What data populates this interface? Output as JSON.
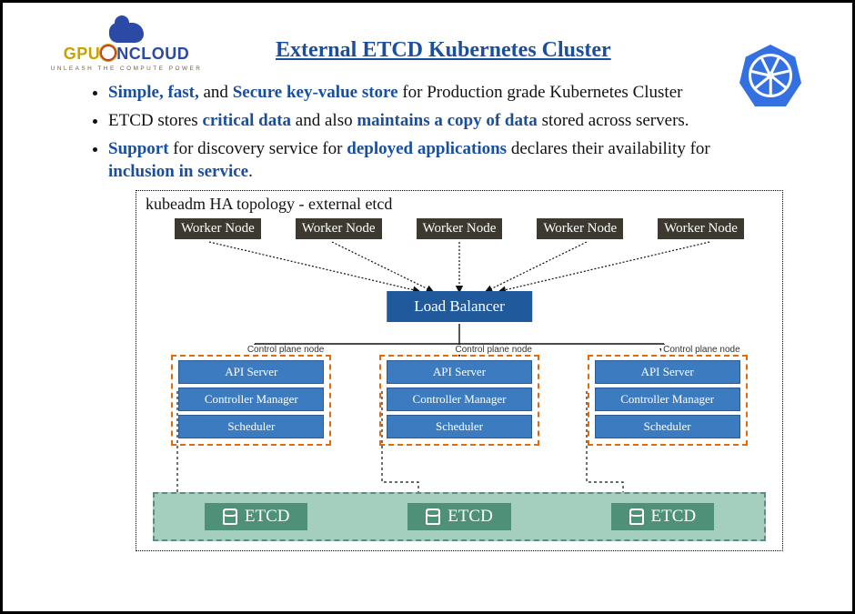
{
  "logo": {
    "brand_1": "GPU",
    "brand_2": "NCLOUD",
    "tagline": "UNLEASH THE COMPUTE POWER"
  },
  "title": "External ETCD Kubernetes Cluster",
  "bullets": {
    "b1": {
      "p1": "Simple, fast,",
      "p2": " and ",
      "p3": "Secure key-value store",
      "p4": " for Production grade Kubernetes Cluster"
    },
    "b2": {
      "p1": "ETCD stores ",
      "p2": "critical data",
      "p3": " and also ",
      "p4": "maintains a copy of data",
      "p5": " stored across servers."
    },
    "b3": {
      "p1": "Support",
      "p2": " for discovery service for ",
      "p3": "deployed applications",
      "p4": " declares their availability for ",
      "p5": "inclusion in service",
      "p6": "."
    }
  },
  "diagram": {
    "title": "kubeadm HA topology - external etcd",
    "worker_label": "Worker Node",
    "lb_label": "Load Balancer",
    "cp_label": "Control plane node",
    "api": "API Server",
    "cm": "Controller Manager",
    "sched": "Scheduler",
    "etcd": "ETCD"
  }
}
